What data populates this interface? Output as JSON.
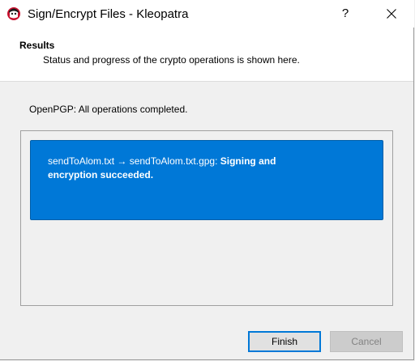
{
  "window": {
    "title": "Sign/Encrypt Files - Kleopatra",
    "help_label": "?"
  },
  "header": {
    "title": "Results",
    "subtitle": "Status and progress of the crypto operations is shown here."
  },
  "status": {
    "text": "OpenPGP: All operations completed."
  },
  "result": {
    "files_text": "sendToAlom.txt → sendToAlom.txt.gpg: ",
    "message_text": "Signing and encryption succeeded.",
    "color": "#0078d7"
  },
  "buttons": {
    "finish_label": "Finish",
    "cancel_label": "Cancel"
  },
  "icons": {
    "app": "kleopatra-icon",
    "close": "close-icon"
  }
}
